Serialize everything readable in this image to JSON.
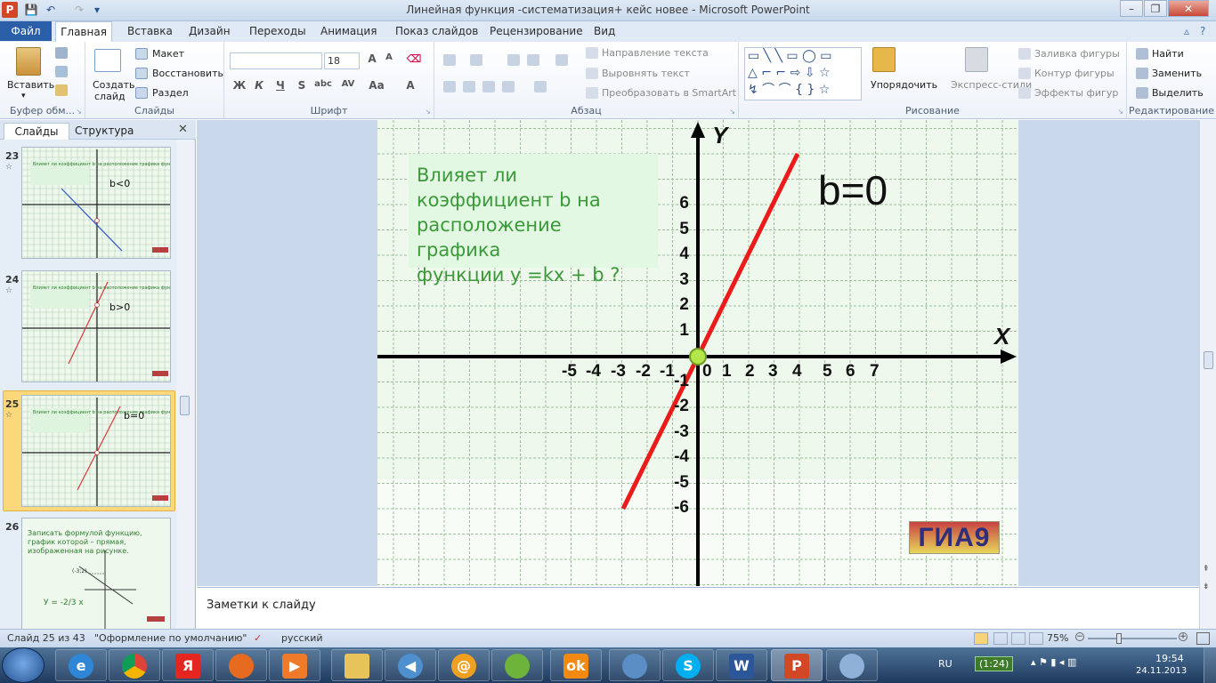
{
  "window": {
    "title": "Линейная функция -систематизация+ кейс новее  -  Microsoft PowerPoint",
    "app_icon": "P",
    "controls": [
      "–",
      "❐",
      "✕"
    ]
  },
  "ribbon_tabs": {
    "file": "Файл",
    "home": "Главная",
    "others": [
      "Вставка",
      "Дизайн",
      "Переходы",
      "Анимация",
      "Показ слайдов",
      "Рецензирование",
      "Вид"
    ]
  },
  "ribbon": {
    "clipboard": {
      "label": "Буфер обм...",
      "paste": "Вставить"
    },
    "slides": {
      "label": "Слайды",
      "new_slide": "Создать",
      "new_slide_2": "слайд",
      "layout": "Макет",
      "reset": "Восстановить",
      "section": "Раздел"
    },
    "font": {
      "label": "Шрифт",
      "font_name": "",
      "font_size": "18",
      "bold": "Ж",
      "italic": "К",
      "underline": "Ч",
      "strike": "S",
      "shadow": "abc",
      "spacing": "AV",
      "case": "Aa",
      "color": "A"
    },
    "paragraph": {
      "label": "Абзац",
      "text_direction": "Направление текста",
      "align_text": "Выровнять текст",
      "smartart": "Преобразовать в SmartArt"
    },
    "drawing": {
      "label": "Рисование",
      "arrange": "Упорядочить",
      "quick_styles": "Экспресс-стили",
      "fill": "Заливка фигуры",
      "outline": "Контур фигуры",
      "effects": "Эффекты фигур"
    },
    "editing": {
      "label": "Редактирование",
      "find": "Найти",
      "replace": "Заменить",
      "select": "Выделить"
    }
  },
  "left_pane": {
    "tab_slides": "Слайды",
    "tab_outline": "Структура",
    "close": "✕",
    "thumbs": [
      {
        "num": "23",
        "label": "b<0",
        "line_color": "#2a56c6"
      },
      {
        "num": "24",
        "label": "b>0",
        "line_color": "#d83a3a"
      },
      {
        "num": "25",
        "label": "b=0",
        "line_color": "#d83a3a"
      },
      {
        "num": "26",
        "text": "Записать формулой функцию, график которой – прямая, изображенная на рисунке.",
        "formula": "У = -2/3 х",
        "point": "(-3;2)"
      }
    ],
    "thumb_caption": "Влияет ли коэффициент b на расположение графика функции  у =kx + b ?"
  },
  "slide": {
    "question_line1": "Влияет ли",
    "question_line2": "коэффициент  b на",
    "question_line3": "расположение  графика",
    "question_line4": "функции   y =kx + b ?",
    "equation": "b=0",
    "axis_x_name": "X",
    "axis_y_name": "Y",
    "badge": "ГИА9",
    "colors": {
      "background": "#eef8ec",
      "grid": "#9fbf9f",
      "line": "#ec1b1b",
      "question_bg": "#e2f8e2",
      "question_text": "#3a9a38"
    }
  },
  "chart_data": {
    "type": "line",
    "title": "b=0",
    "xlabel": "X",
    "ylabel": "Y",
    "x_tick_labels": [
      "-5",
      "-4",
      "-3",
      "-2",
      "-1",
      "0",
      "1",
      "2",
      "3",
      "4",
      "5",
      "6",
      "7"
    ],
    "y_tick_labels": [
      "6",
      "5",
      "4",
      "3",
      "2",
      "1",
      "-1",
      "-2",
      "-3",
      "-4",
      "-5",
      "-6"
    ],
    "series": [
      {
        "values": [
          [
            -3,
            -6
          ],
          [
            4,
            8
          ]
        ]
      }
    ],
    "highlight_point": [
      0,
      0
    ],
    "grid": true
  },
  "notes": {
    "label": "Заметки к слайду"
  },
  "status": {
    "slide": "Слайд 25 из 43",
    "theme": "\"Оформление по умолчанию\"",
    "lang": "русский",
    "zoom": "75%"
  },
  "taskbar": {
    "lang": "RU",
    "battery": "(1:24)",
    "time": "19:54",
    "date": "24.11.2013"
  }
}
